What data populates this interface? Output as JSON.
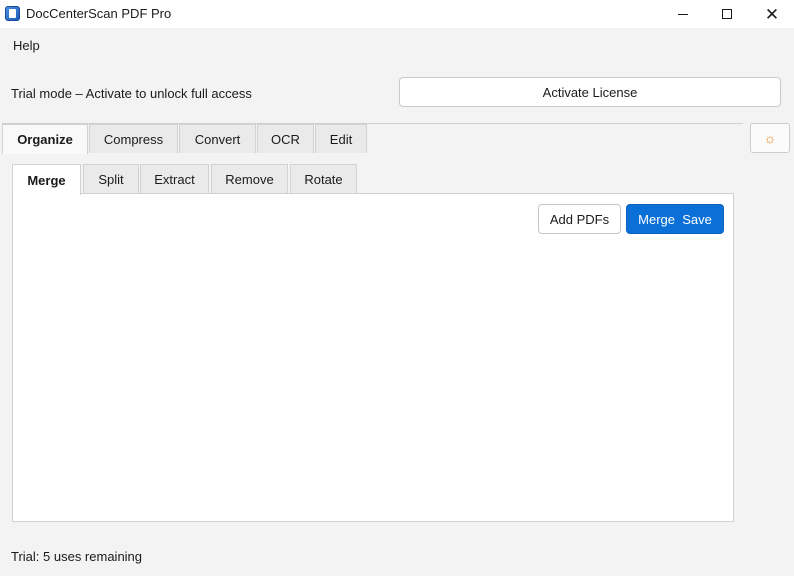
{
  "window": {
    "title": "DocCenterScan PDF Pro",
    "minimize_icon": "minimize-icon",
    "maximize_icon": "maximize-icon",
    "close_icon": "close-icon",
    "close_glyph": "✕"
  },
  "menu": {
    "help": "Help"
  },
  "trial": {
    "message": "Trial mode – Activate to unlock full access",
    "activate_label": "Activate License"
  },
  "main_tabs": [
    {
      "label": "Organize",
      "active": true
    },
    {
      "label": "Compress",
      "active": false
    },
    {
      "label": "Convert",
      "active": false
    },
    {
      "label": "OCR",
      "active": false
    },
    {
      "label": "Edit",
      "active": false
    }
  ],
  "settings": {
    "icon": "sun-icon",
    "glyph": "☼",
    "color": "#e08a1e"
  },
  "sub_tabs": [
    {
      "label": "Merge",
      "active": true
    },
    {
      "label": "Split",
      "active": false
    },
    {
      "label": "Extract",
      "active": false
    },
    {
      "label": "Remove",
      "active": false
    },
    {
      "label": "Rotate",
      "active": false
    }
  ],
  "merge_panel": {
    "add_label": "Add PDFs",
    "merge_label": "Merge  Save",
    "accent_color": "#0a6fd6"
  },
  "status": {
    "text": "Trial: 5 uses remaining"
  }
}
